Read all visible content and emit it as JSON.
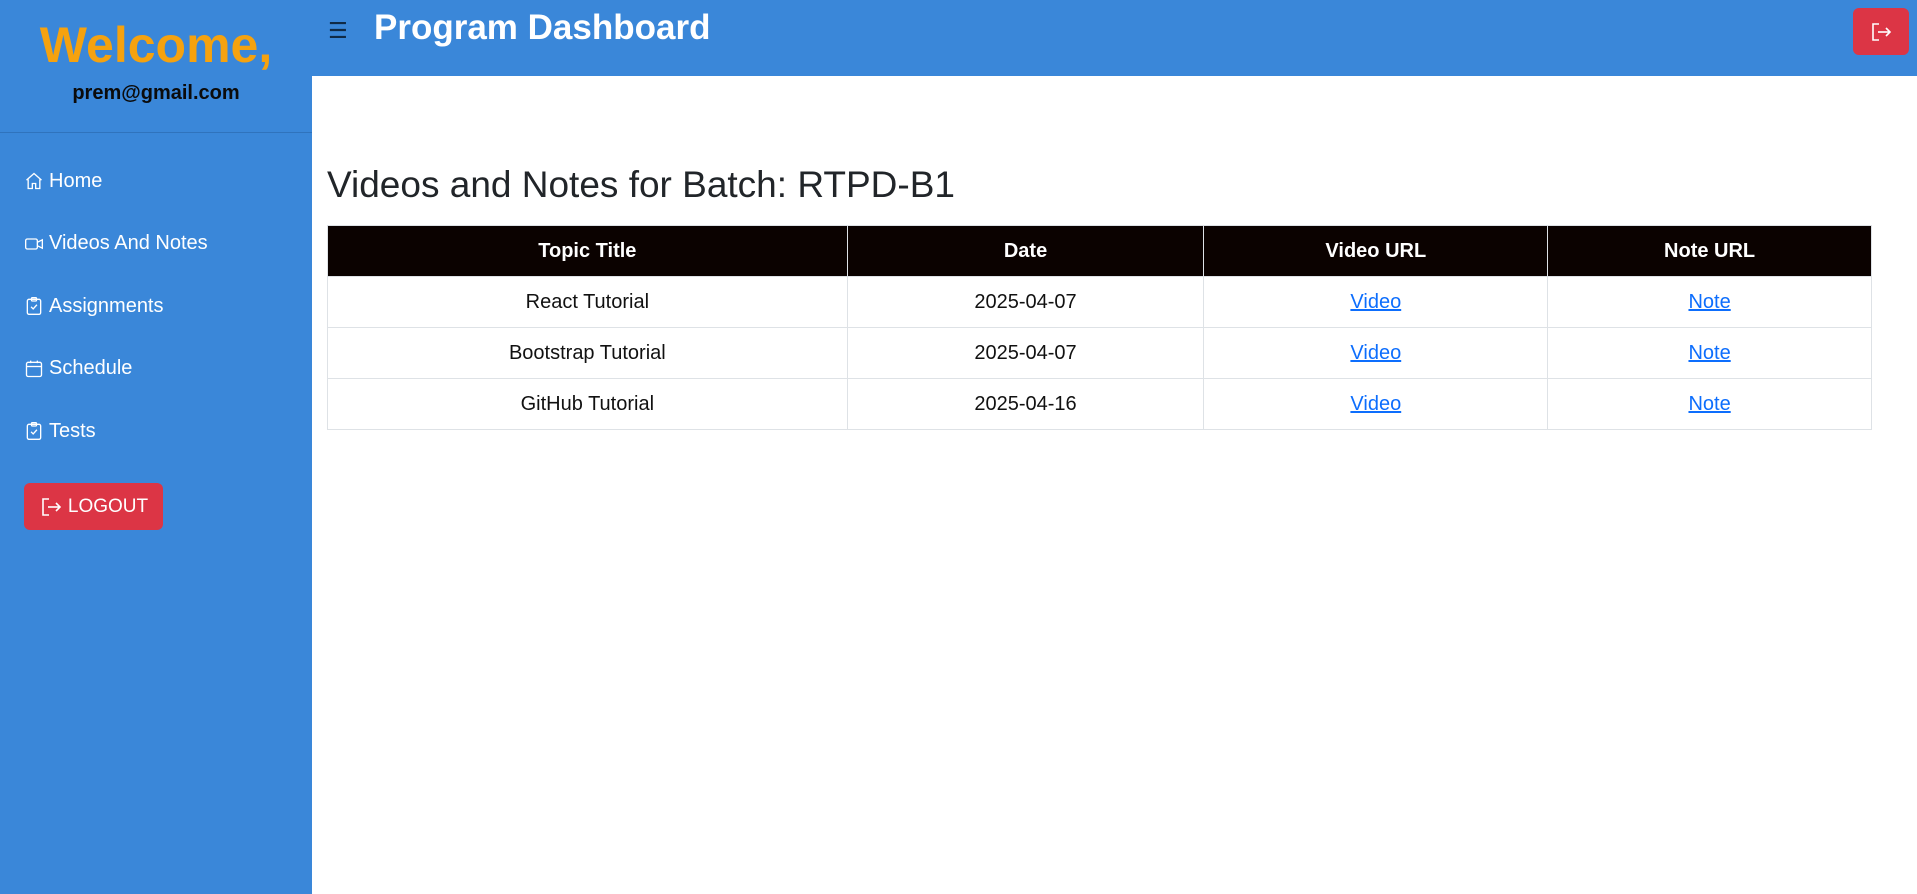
{
  "sidebar": {
    "welcome": "Welcome,",
    "email": "prem@gmail.com",
    "items": [
      {
        "label": "Home",
        "icon": "home-icon"
      },
      {
        "label": "Videos And Notes",
        "icon": "video-icon"
      },
      {
        "label": "Assignments",
        "icon": "clipboard-check-icon"
      },
      {
        "label": "Schedule",
        "icon": "calendar-icon"
      },
      {
        "label": "Tests",
        "icon": "clipboard-check-icon"
      }
    ],
    "logout_label": "LOGOUT"
  },
  "header": {
    "menu_icon": "☰",
    "title": "Program Dashboard"
  },
  "main": {
    "page_title": "Videos and Notes for Batch: RTPD-B1",
    "table": {
      "headers": [
        "Topic Title",
        "Date",
        "Video URL",
        "Note URL"
      ],
      "rows": [
        {
          "topic": "React Tutorial",
          "date": "2025-04-07",
          "video": "Video",
          "note": "Note"
        },
        {
          "topic": "Bootstrap Tutorial",
          "date": "2025-04-07",
          "video": "Video",
          "note": "Note"
        },
        {
          "topic": "GitHub Tutorial",
          "date": "2025-04-16",
          "video": "Video",
          "note": "Note"
        }
      ]
    }
  },
  "colors": {
    "sidebar_bg": "#3a87d9",
    "welcome": "#f5a20f",
    "danger": "#dc3545",
    "table_header_bg": "#0b0200",
    "link": "#0d6efd"
  }
}
